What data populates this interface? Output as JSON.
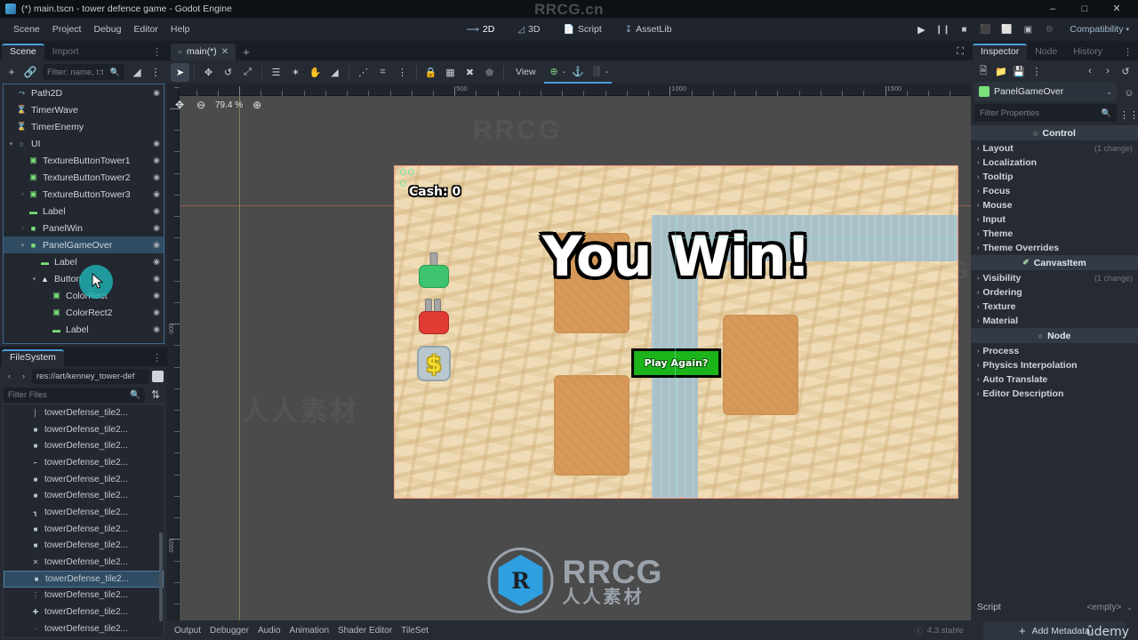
{
  "window": {
    "title": "(*) main.tscn - tower defence game - Godot Engine",
    "icon": "godot-icon",
    "minimize": "–",
    "maximize": "□",
    "close": "✕"
  },
  "watermarks": {
    "top": "RRCG.cn",
    "logo_letter": "R",
    "brand": "RRCG",
    "brand_cn": "人人素材",
    "udemy": "ûdemy",
    "ghost1": "RRCG",
    "ghost2": "人人素材",
    "ghost3": "RRCG.cn"
  },
  "menubar": {
    "items": [
      "Scene",
      "Project",
      "Debug",
      "Editor",
      "Help"
    ],
    "modes": [
      {
        "label": "2D",
        "icon": "2d-icon",
        "active": true
      },
      {
        "label": "3D",
        "icon": "3d-icon",
        "active": false
      },
      {
        "label": "Script",
        "icon": "script-icon",
        "active": false
      },
      {
        "label": "AssetLib",
        "icon": "assetlib-icon",
        "active": false
      }
    ],
    "run_controls": [
      {
        "name": "play-project-button",
        "glyph": "▶"
      },
      {
        "name": "pause-project-button",
        "glyph": "❙❙"
      },
      {
        "name": "stop-project-button",
        "glyph": "■"
      },
      {
        "name": "play-scene-button",
        "glyph": "⬛"
      },
      {
        "name": "play-custom-scene-button",
        "glyph": "⬜"
      },
      {
        "name": "movie-writer-button",
        "glyph": "▣"
      },
      {
        "name": "remote-debug-button",
        "glyph": "⚙"
      }
    ],
    "renderer": "Compatibility"
  },
  "left_dock": {
    "tabs": [
      {
        "label": "Scene",
        "active": true
      },
      {
        "label": "Import",
        "active": false
      }
    ],
    "toolbar": {
      "add_node": "+",
      "instantiate": "🔗",
      "filter_placeholder": "Filter: name, t:t",
      "search_icon": "search-icon",
      "tree_options_icon": "tree-options-icon",
      "more_icon": "more-icon"
    },
    "tree": [
      {
        "label": "Path2D",
        "indent": 1,
        "icon": "path2d-icon",
        "icon_color": "#8fd0f0",
        "glyph": "⤳",
        "expander": "",
        "eye": true,
        "selected": false
      },
      {
        "label": "TimerWave",
        "indent": 1,
        "icon": "timer-icon",
        "icon_color": "#e6e9ee",
        "glyph": "⌛",
        "expander": "",
        "eye": false,
        "selected": false
      },
      {
        "label": "TimerEnemy",
        "indent": 1,
        "icon": "timer-icon",
        "icon_color": "#e6e9ee",
        "glyph": "⌛",
        "expander": "",
        "eye": false,
        "selected": false
      },
      {
        "label": "UI",
        "indent": 1,
        "icon": "control-icon",
        "icon_color": "#8fb8e8",
        "glyph": "○",
        "expander": "▾",
        "eye": true,
        "selected": false
      },
      {
        "label": "TextureButtonTower1",
        "indent": 2,
        "icon": "texturebutton-icon",
        "icon_color": "#7ae07a",
        "glyph": "▣",
        "expander": "",
        "eye": true,
        "selected": false
      },
      {
        "label": "TextureButtonTower2",
        "indent": 2,
        "icon": "texturebutton-icon",
        "icon_color": "#7ae07a",
        "glyph": "▣",
        "expander": "",
        "eye": true,
        "selected": false
      },
      {
        "label": "TextureButtonTower3",
        "indent": 2,
        "icon": "texturebutton-icon",
        "icon_color": "#7ae07a",
        "glyph": "▣",
        "expander": "›",
        "eye": true,
        "selected": false
      },
      {
        "label": "Label",
        "indent": 2,
        "icon": "label-icon",
        "icon_color": "#7ae07a",
        "glyph": "▬",
        "expander": "",
        "eye": true,
        "selected": false
      },
      {
        "label": "PanelWin",
        "indent": 2,
        "icon": "panel-icon",
        "icon_color": "#7ae07a",
        "glyph": "■",
        "expander": "›",
        "eye": true,
        "selected": false
      },
      {
        "label": "PanelGameOver",
        "indent": 2,
        "icon": "panel-icon",
        "icon_color": "#7ae07a",
        "glyph": "■",
        "expander": "▾",
        "eye": true,
        "selected": true
      },
      {
        "label": "Label",
        "indent": 3,
        "icon": "label-icon",
        "icon_color": "#7ae07a",
        "glyph": "▬",
        "expander": "",
        "eye": true,
        "selected": false
      },
      {
        "label": "Button",
        "indent": 3,
        "icon": "button-icon",
        "icon_color": "#dfe3e8",
        "glyph": "▲",
        "expander": "▾",
        "eye": true,
        "selected": false
      },
      {
        "label": "ColorRect",
        "indent": 4,
        "icon": "colorrect-icon",
        "icon_color": "#7ae07a",
        "glyph": "▣",
        "expander": "",
        "eye": true,
        "selected": false
      },
      {
        "label": "ColorRect2",
        "indent": 4,
        "icon": "colorrect-icon",
        "icon_color": "#7ae07a",
        "glyph": "▣",
        "expander": "",
        "eye": true,
        "selected": false
      },
      {
        "label": "Label",
        "indent": 4,
        "icon": "label-icon",
        "icon_color": "#7ae07a",
        "glyph": "▬",
        "expander": "",
        "eye": true,
        "selected": false
      }
    ]
  },
  "filesystem": {
    "tab": "FileSystem",
    "more_icon": "more-icon",
    "back_icon": "back-icon",
    "forward_icon": "forward-icon",
    "path": "res://art/kenney_tower-def",
    "filter_placeholder": "Filter Files",
    "search_icon": "search-icon",
    "sort_icon": "sort-icon",
    "files": [
      {
        "label": "towerDefense_tile2...",
        "glyph": "│",
        "selected": false
      },
      {
        "label": "towerDefense_tile2...",
        "glyph": "■",
        "selected": false
      },
      {
        "label": "towerDefense_tile2...",
        "glyph": "■",
        "selected": false
      },
      {
        "label": "towerDefense_tile2...",
        "glyph": "⌐",
        "selected": false
      },
      {
        "label": "towerDefense_tile2...",
        "glyph": "■",
        "selected": false
      },
      {
        "label": "towerDefense_tile2...",
        "glyph": "■",
        "selected": false
      },
      {
        "label": "towerDefense_tile2...",
        "glyph": "┓",
        "selected": false
      },
      {
        "label": "towerDefense_tile2...",
        "glyph": "■",
        "selected": false
      },
      {
        "label": "towerDefense_tile2...",
        "glyph": "■",
        "selected": false
      },
      {
        "label": "towerDefense_tile2...",
        "glyph": "✕",
        "selected": false
      },
      {
        "label": "towerDefense_tile2...",
        "glyph": "■",
        "selected": true
      },
      {
        "label": "towerDefense_tile2...",
        "glyph": "⋮",
        "selected": false
      },
      {
        "label": "towerDefense_tile2...",
        "glyph": "✚",
        "selected": false
      },
      {
        "label": "towerDefense_tile2...",
        "glyph": "·",
        "selected": false
      }
    ]
  },
  "editor": {
    "tabs": [
      {
        "label": "main(*)",
        "active": true,
        "close": "✕"
      }
    ],
    "add_tab": "+",
    "expand_icon": "expand-icon",
    "toolbar": [
      {
        "name": "select-mode-button",
        "glyph": "➤",
        "active": true
      },
      {
        "name": "move-mode-button",
        "glyph": "✥",
        "active": false
      },
      {
        "name": "rotate-mode-button",
        "glyph": "↺",
        "active": false
      },
      {
        "name": "scale-mode-button",
        "glyph": "⤢",
        "active": false
      },
      {
        "name": "list-select-button",
        "glyph": "☰",
        "active": false
      },
      {
        "name": "ruler-mode-button",
        "glyph": "✶",
        "active": false
      },
      {
        "name": "pan-mode-button",
        "glyph": "✋",
        "active": false
      },
      {
        "name": "ruler-tool-button",
        "glyph": "◢",
        "active": false
      },
      {
        "name": "smart-snap-button",
        "glyph": "⋰",
        "active": false
      },
      {
        "name": "grid-snap-button",
        "glyph": "⌗",
        "active": false
      },
      {
        "name": "snap-options-button",
        "glyph": "⋮",
        "active": false
      },
      {
        "name": "lock-button",
        "glyph": "🔒",
        "active": false
      },
      {
        "name": "group-button",
        "glyph": "▦",
        "active": false
      },
      {
        "name": "skeleton-button",
        "glyph": "✖",
        "active": false
      },
      {
        "name": "bone-button",
        "glyph": "⬟",
        "active": false,
        "dim": true
      }
    ],
    "view_label": "View",
    "right_tools": [
      {
        "name": "add-node-overlay-button",
        "glyph": "⊕",
        "caret": "⌄"
      },
      {
        "name": "anchor-button",
        "glyph": "⚓",
        "caret": ""
      },
      {
        "name": "grid-visibility-button",
        "glyph": "░",
        "caret": "⌄"
      }
    ]
  },
  "viewport": {
    "zoom_reset_icon": "zoom-reset-icon",
    "zoom_out": "⊖",
    "zoom_level": "79.4 %",
    "zoom_in": "⊕",
    "ruler_labels": [
      "500",
      "1000",
      "1500"
    ],
    "ruler_labels_v": [
      "500"
    ]
  },
  "game": {
    "cash_label": "Cash: 0",
    "win_title": "You Win!",
    "play_again": "Play Again?",
    "tower_buttons": [
      {
        "name": "tower-button-green",
        "color": "#3ec46e",
        "barrels": 1
      },
      {
        "name": "tower-button-red",
        "color": "#e03c34",
        "barrels": 2
      }
    ],
    "coin_button": {
      "name": "coin-button",
      "symbol": "$"
    },
    "colors": {
      "sand": "#efdcb6",
      "road": "#a8c0c8",
      "plot": "#d79a5b",
      "button_green": "#1bb51b"
    }
  },
  "bottom_panels": {
    "items": [
      "Output",
      "Debugger",
      "Audio",
      "Animation",
      "Shader Editor",
      "TileSet"
    ],
    "version": "4.3.stable",
    "version_icon": "info-icon"
  },
  "inspector": {
    "tabs": [
      {
        "label": "Inspector",
        "active": true
      },
      {
        "label": "Node",
        "active": false
      },
      {
        "label": "History",
        "active": false
      }
    ],
    "more_icon": "more-icon",
    "toolbar": [
      {
        "name": "new-resource-button",
        "glyph": "🗎"
      },
      {
        "name": "open-resource-button",
        "glyph": "📁"
      },
      {
        "name": "save-resource-button",
        "glyph": "💾"
      },
      {
        "name": "resource-menu-button",
        "glyph": "⋮"
      },
      {
        "name": "history-back-button",
        "glyph": "‹"
      },
      {
        "name": "history-forward-button",
        "glyph": "›"
      },
      {
        "name": "history-button",
        "glyph": "↺"
      }
    ],
    "object": {
      "name": "PanelGameOver",
      "dropdown": "⌄",
      "open_docs_icon": "open-docs-icon"
    },
    "filter_placeholder": "Filter Properties",
    "search_icon": "search-icon",
    "options_icon": "property-options-icon",
    "sections": [
      {
        "type": "category",
        "label": "Control",
        "icon": "control-icon"
      },
      {
        "type": "prop",
        "label": "Layout",
        "change": "(1 change)"
      },
      {
        "type": "prop",
        "label": "Localization",
        "change": ""
      },
      {
        "type": "prop",
        "label": "Tooltip",
        "change": ""
      },
      {
        "type": "prop",
        "label": "Focus",
        "change": ""
      },
      {
        "type": "prop",
        "label": "Mouse",
        "change": ""
      },
      {
        "type": "prop",
        "label": "Input",
        "change": ""
      },
      {
        "type": "prop",
        "label": "Theme",
        "change": ""
      },
      {
        "type": "prop",
        "label": "Theme Overrides",
        "change": ""
      },
      {
        "type": "category",
        "label": "CanvasItem",
        "icon": "canvasitem-icon"
      },
      {
        "type": "prop",
        "label": "Visibility",
        "change": "(1 change)"
      },
      {
        "type": "prop",
        "label": "Ordering",
        "change": ""
      },
      {
        "type": "prop",
        "label": "Texture",
        "change": ""
      },
      {
        "type": "prop",
        "label": "Material",
        "change": ""
      },
      {
        "type": "category",
        "label": "Node",
        "icon": "node-icon"
      },
      {
        "type": "prop",
        "label": "Process",
        "change": ""
      },
      {
        "type": "prop",
        "label": "Physics Interpolation",
        "change": ""
      },
      {
        "type": "prop",
        "label": "Auto Translate",
        "change": ""
      },
      {
        "type": "prop",
        "label": "Editor Description",
        "change": ""
      }
    ],
    "script": {
      "label": "Script",
      "value": "<empty>",
      "caret": "⌄"
    },
    "add_metadata": {
      "plus": "+",
      "label": "Add Metadata"
    }
  }
}
